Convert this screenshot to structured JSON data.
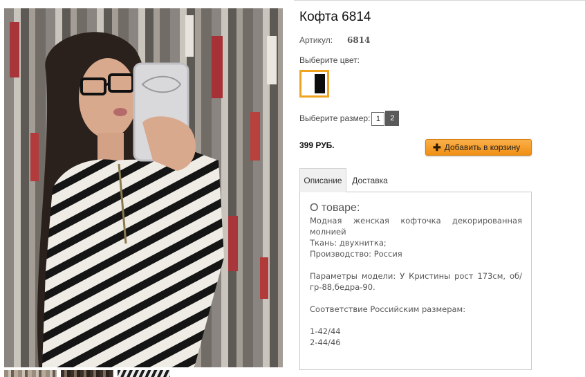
{
  "product": {
    "title": "Кофта 6814",
    "article_label": "Артикул:",
    "article_value": "6814",
    "color_label": "Выберите цвет:",
    "swatch_colors": [
      "#ffffff",
      "#0d0d0d"
    ],
    "size_label": "Выберите размер:",
    "sizes": [
      {
        "label": "1",
        "selected": false
      },
      {
        "label": "2",
        "selected": true
      }
    ],
    "price": "399 РУБ.",
    "add_to_cart_label": "Добавить в корзину",
    "add_to_cart_icon": "plus-icon"
  },
  "tabs": [
    {
      "label": "Описание",
      "active": true
    },
    {
      "label": "Доставка",
      "active": false
    }
  ],
  "description": {
    "heading": "О товаре:",
    "lines": [
      "Модная женская кофточка декорированная молнией",
      "Ткань: двухнитка;",
      "Производство: Россия",
      "",
      "Параметры модели: У Кристины рост 173см, об/гр-88,бедра-90.",
      "",
      "Соответствие Российским размерам:",
      "",
      "1-42/44",
      "2-44/46"
    ]
  },
  "colors": {
    "accent": "#f0a31e",
    "button_top": "#fbb04a",
    "button_bottom": "#f08f14",
    "selected_size_bg": "#5a5a5a"
  }
}
